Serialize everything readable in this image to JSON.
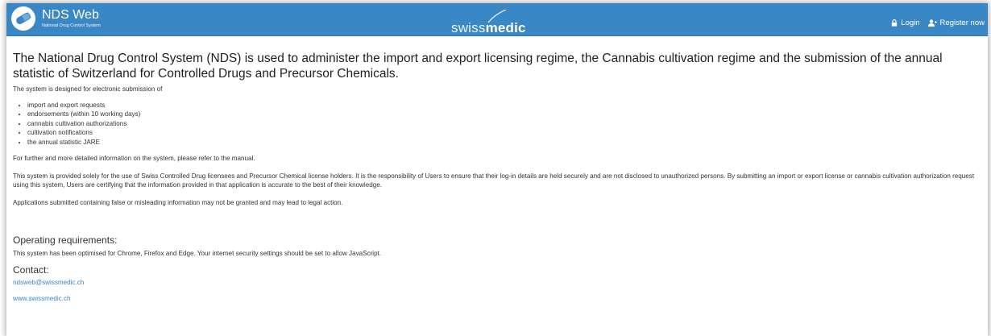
{
  "header": {
    "brand_title": "NDS Web",
    "brand_subtitle": "National Drug Control System",
    "center_logo_light": "swiss",
    "center_logo_bold": "medic",
    "login_label": "Login",
    "register_label": "Register now",
    "bar_color": "#3a87c5"
  },
  "main": {
    "intro": "The National Drug Control System (NDS) is used to administer the import and export licensing regime, the Cannabis cultivation regime and the submission of the annual statistic of Switzerland for Controlled Drugs and Precursor Chemicals.",
    "designed_for": "The system is designed for electronic submission of",
    "features": [
      "import and export requests",
      "endorsements (within 10 working days)",
      "cannabis cultivation authorizations",
      "cultivation notifications",
      "the annual statistic JARE"
    ],
    "manual_note": "For further and more detailed information on the system, please refer to the manual.",
    "provided_note": "This system is provided solely for the use of Swiss Controlled Drug licensees and Precursor Chemical license holders. It is the responsibility of Users to ensure that their log-in details are held securely and are not disclosed to unauthorized persons. By submitting an import or export license or cannabis cultivation authorization request using this system, Users are certifying that the information provided in that application is accurate to the best of their knowledge.",
    "false_info_note": "Applications submitted containing false or misleading information may not be granted and may lead to legal action.",
    "operating_heading": "Operating requirements:",
    "operating_text": "This system has been optimised for Chrome, Firefox and Edge. Your internet security settings should be set to allow JavaScript.",
    "contact_heading": "Contact:",
    "contact_email": "ndsweb@swissmedic.ch",
    "contact_website": "www.swissmedic.ch"
  },
  "icons": {
    "brand": "pill-logo-icon",
    "login": "lock-icon",
    "register": "add-user-icon"
  }
}
